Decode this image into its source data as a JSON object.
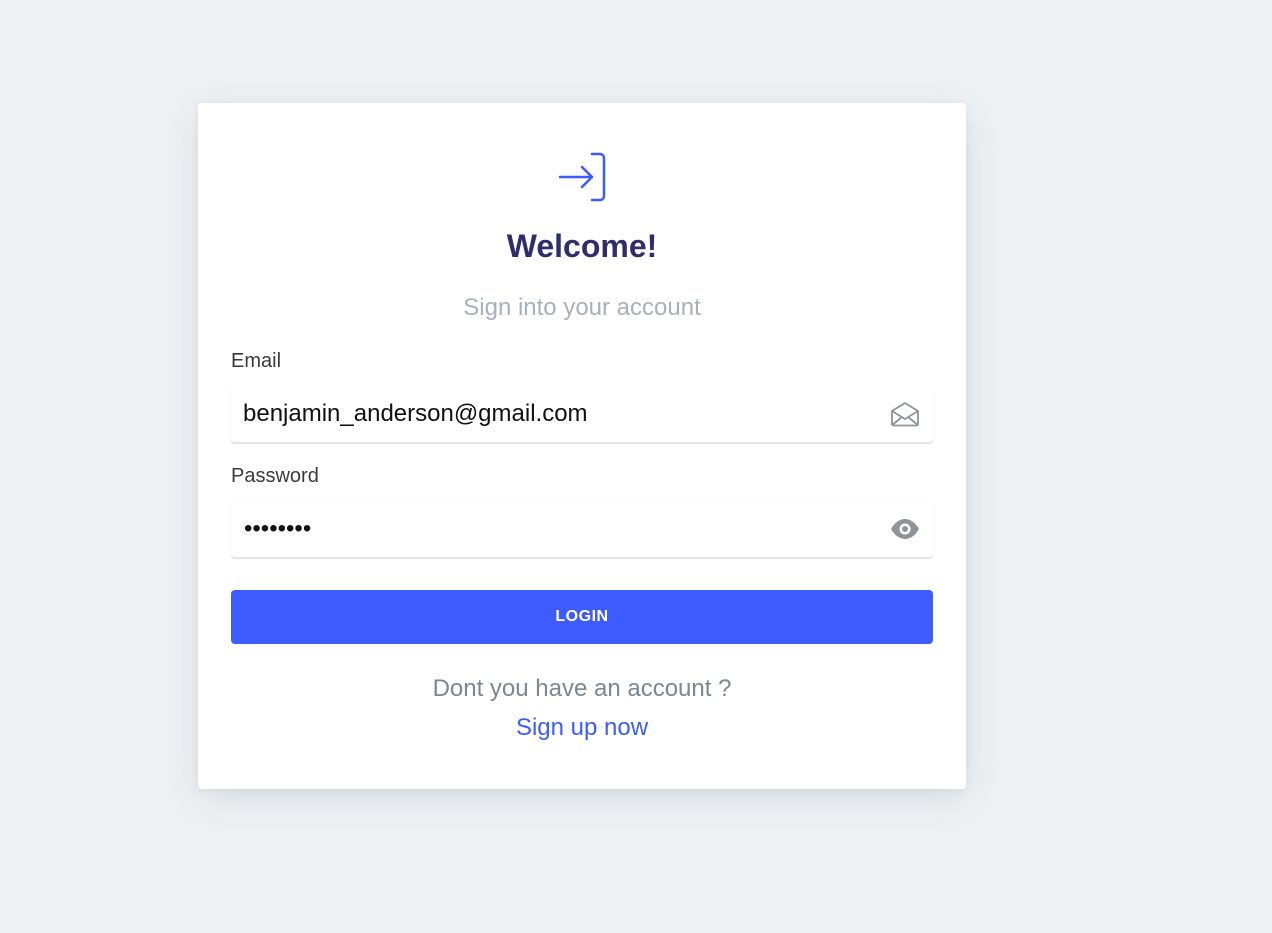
{
  "colors": {
    "background": "#eef1f4",
    "card": "#ffffff",
    "accent": "#3e5bff",
    "title": "#2f2d6b",
    "muted": "#a9b0ba"
  },
  "header": {
    "icon": "login-icon",
    "title": "Welcome!",
    "subtitle": "Sign into your account"
  },
  "form": {
    "email": {
      "label": "Email",
      "value": "benjamin_anderson@gmail.com",
      "icon": "envelope-icon"
    },
    "password": {
      "label": "Password",
      "masked_value": "••••••••",
      "icon": "eye-icon"
    },
    "login_label": "LOGIN"
  },
  "footer": {
    "question": "Dont you have an account ?",
    "signup_label": "Sign up now"
  }
}
